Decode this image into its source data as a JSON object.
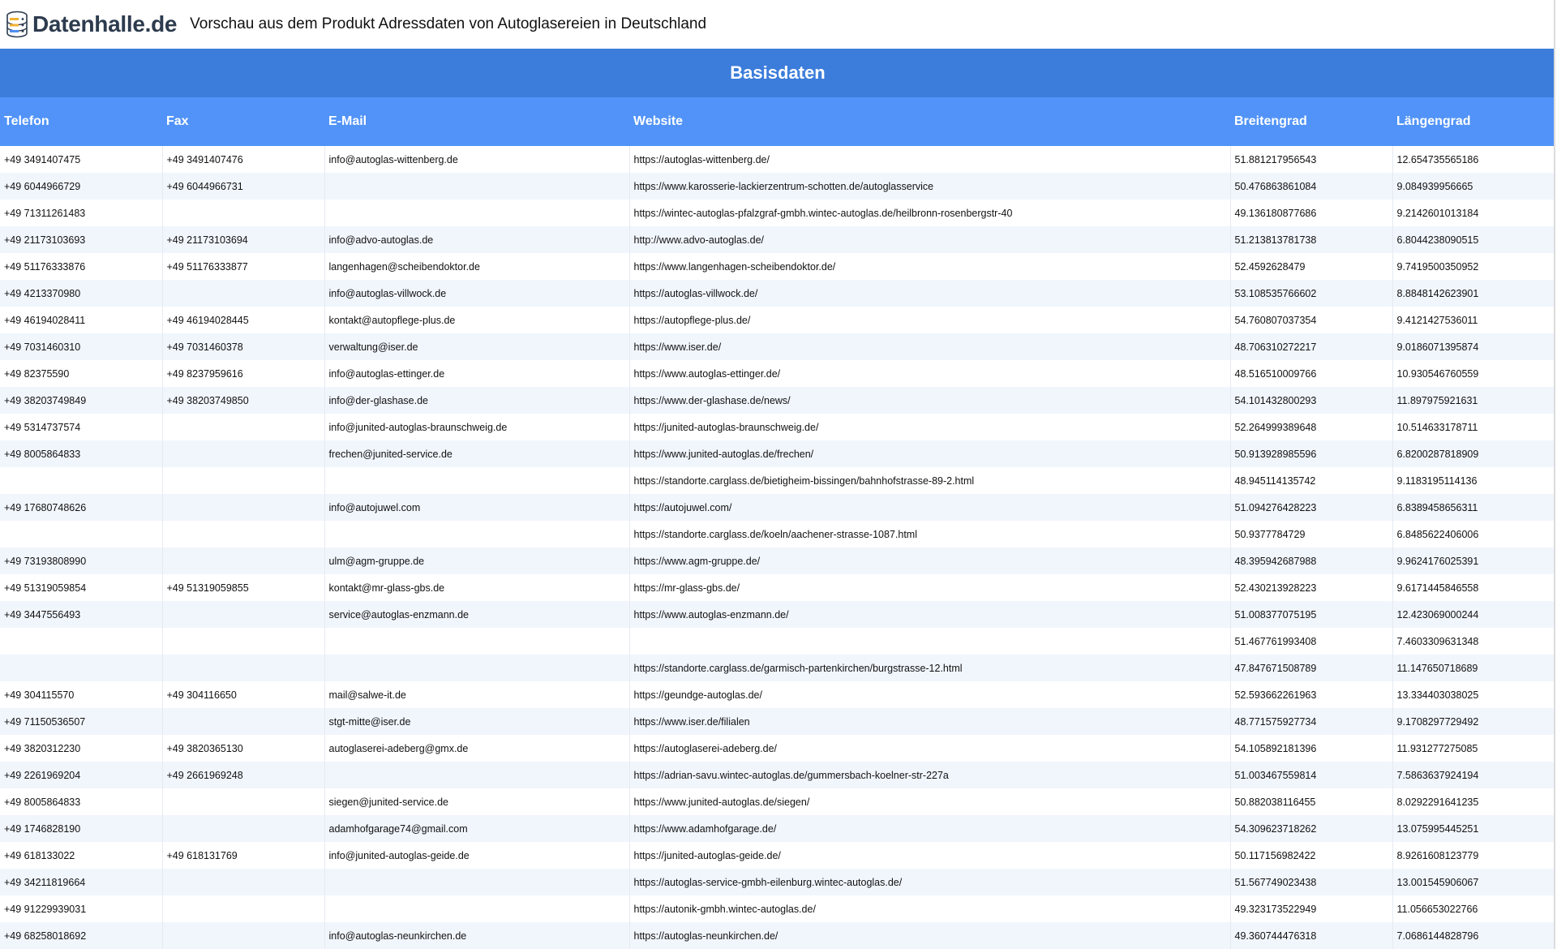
{
  "header": {
    "logo_text": "Datenhalle.de",
    "title": "Vorschau aus dem Produkt Adressdaten von Autoglasereien in Deutschland"
  },
  "section": {
    "title": "Basisdaten"
  },
  "table": {
    "columns": [
      "Telefon",
      "Fax",
      "E-Mail",
      "Website",
      "Breitengrad",
      "Längengrad"
    ],
    "rows": [
      [
        "+49 3491407475",
        "+49 3491407476",
        "info@autoglas-wittenberg.de",
        "https://autoglas-wittenberg.de/",
        "51.881217956543",
        "12.654735565186"
      ],
      [
        "+49 6044966729",
        "+49 6044966731",
        "",
        "https://www.karosserie-lackierzentrum-schotten.de/autoglasservice",
        "50.476863861084",
        "9.084939956665"
      ],
      [
        "+49 71311261483",
        "",
        "",
        "https://wintec-autoglas-pfalzgraf-gmbh.wintec-autoglas.de/heilbronn-rosenbergstr-40",
        "49.136180877686",
        "9.2142601013184"
      ],
      [
        "+49 21173103693",
        "+49 21173103694",
        "info@advo-autoglas.de",
        "http://www.advo-autoglas.de/",
        "51.213813781738",
        "6.8044238090515"
      ],
      [
        "+49 51176333876",
        "+49 51176333877",
        "langenhagen@scheibendoktor.de",
        "https://www.langenhagen-scheibendoktor.de/",
        "52.4592628479",
        "9.7419500350952"
      ],
      [
        "+49 4213370980",
        "",
        "info@autoglas-villwock.de",
        "https://autoglas-villwock.de/",
        "53.108535766602",
        "8.8848142623901"
      ],
      [
        "+49 46194028411",
        "+49 46194028445",
        "kontakt@autopflege-plus.de",
        "https://autopflege-plus.de/",
        "54.760807037354",
        "9.4121427536011"
      ],
      [
        "+49 7031460310",
        "+49 7031460378",
        "verwaltung@iser.de",
        "https://www.iser.de/",
        "48.706310272217",
        "9.0186071395874"
      ],
      [
        "+49 82375590",
        "+49 8237959616",
        "info@autoglas-ettinger.de",
        "https://www.autoglas-ettinger.de/",
        "48.516510009766",
        "10.930546760559"
      ],
      [
        "+49 38203749849",
        "+49 38203749850",
        "info@der-glashase.de",
        "https://www.der-glashase.de/news/",
        "54.101432800293",
        "11.897975921631"
      ],
      [
        "+49 5314737574",
        "",
        "info@junited-autoglas-braunschweig.de",
        "https://junited-autoglas-braunschweig.de/",
        "52.264999389648",
        "10.514633178711"
      ],
      [
        "+49 8005864833",
        "",
        "frechen@junited-service.de",
        "https://www.junited-autoglas.de/frechen/",
        "50.913928985596",
        "6.8200287818909"
      ],
      [
        "",
        "",
        "",
        "https://standorte.carglass.de/bietigheim-bissingen/bahnhofstrasse-89-2.html",
        "48.945114135742",
        "9.1183195114136"
      ],
      [
        "+49 17680748626",
        "",
        "info@autojuwel.com",
        "https://autojuwel.com/",
        "51.094276428223",
        "6.8389458656311"
      ],
      [
        "",
        "",
        "",
        "https://standorte.carglass.de/koeln/aachener-strasse-1087.html",
        "50.9377784729",
        "6.8485622406006"
      ],
      [
        "+49 73193808990",
        "",
        "ulm@agm-gruppe.de",
        "https://www.agm-gruppe.de/",
        "48.395942687988",
        "9.9624176025391"
      ],
      [
        "+49 51319059854",
        "+49 51319059855",
        "kontakt@mr-glass-gbs.de",
        "https://mr-glass-gbs.de/",
        "52.430213928223",
        "9.6171445846558"
      ],
      [
        "+49 3447556493",
        "",
        "service@autoglas-enzmann.de",
        "https://www.autoglas-enzmann.de/",
        "51.008377075195",
        "12.423069000244"
      ],
      [
        "",
        "",
        "",
        "",
        "51.467761993408",
        "7.4603309631348"
      ],
      [
        "",
        "",
        "",
        "https://standorte.carglass.de/garmisch-partenkirchen/burgstrasse-12.html",
        "47.847671508789",
        "11.147650718689"
      ],
      [
        "+49 304115570",
        "+49 304116650",
        "mail@salwe-it.de",
        "https://geundge-autoglas.de/",
        "52.593662261963",
        "13.334403038025"
      ],
      [
        "+49 71150536507",
        "",
        "stgt-mitte@iser.de",
        "https://www.iser.de/filialen",
        "48.771575927734",
        "9.1708297729492"
      ],
      [
        "+49 3820312230",
        "+49 3820365130",
        "autoglaserei-adeberg@gmx.de",
        "https://autoglaserei-adeberg.de/",
        "54.105892181396",
        "11.931277275085"
      ],
      [
        "+49 2261969204",
        "+49 2661969248",
        "",
        "https://adrian-savu.wintec-autoglas.de/gummersbach-koelner-str-227a",
        "51.003467559814",
        "7.5863637924194"
      ],
      [
        "+49 8005864833",
        "",
        "siegen@junited-service.de",
        "https://www.junited-autoglas.de/siegen/",
        "50.882038116455",
        "8.0292291641235"
      ],
      [
        "+49 1746828190",
        "",
        "adamhofgarage74@gmail.com",
        "https://www.adamhofgarage.de/",
        "54.309623718262",
        "13.075995445251"
      ],
      [
        "+49 618133022",
        "+49 618131769",
        "info@junited-autoglas-geide.de",
        "https://junited-autoglas-geide.de/",
        "50.117156982422",
        "8.9261608123779"
      ],
      [
        "+49 34211819664",
        "",
        "",
        "https://autoglas-service-gmbh-eilenburg.wintec-autoglas.de/",
        "51.567749023438",
        "13.001545906067"
      ],
      [
        "+49 91229939031",
        "",
        "",
        "https://autonik-gmbh.wintec-autoglas.de/",
        "49.323173522949",
        "11.056653022766"
      ],
      [
        "+49 68258018692",
        "",
        "info@autoglas-neunkirchen.de",
        "https://autoglas-neunkirchen.de/",
        "49.360744476318",
        "7.0686144828796"
      ]
    ]
  }
}
